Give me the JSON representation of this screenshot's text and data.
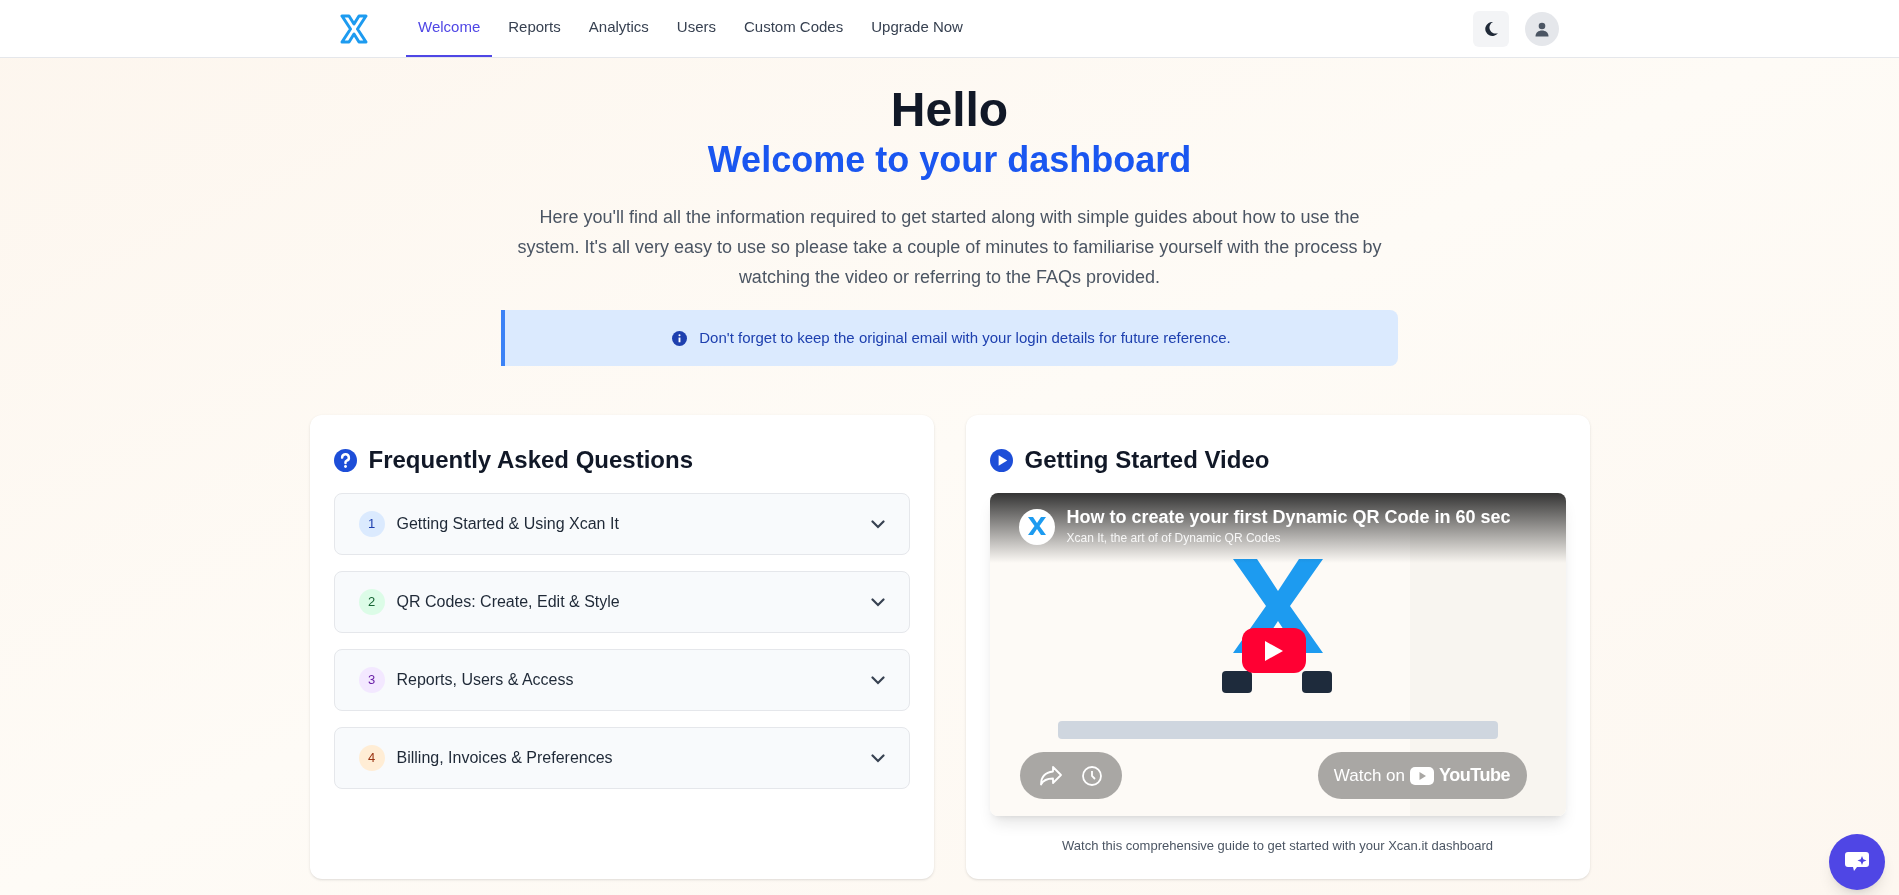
{
  "nav": {
    "tabs": [
      {
        "label": "Welcome",
        "selected": true
      },
      {
        "label": "Reports",
        "selected": false
      },
      {
        "label": "Analytics",
        "selected": false
      },
      {
        "label": "Users",
        "selected": false
      },
      {
        "label": "Custom Codes",
        "selected": false
      },
      {
        "label": "Upgrade Now",
        "selected": false
      }
    ]
  },
  "header": {
    "title": "Hello",
    "subtitle": "Welcome to your dashboard",
    "intro": "Here you'll find all the information required to get started along with simple guides about how to use the system. It's all very easy to use so please take a couple of minutes to familiarise yourself with the process by watching the video or referring to the FAQs provided.",
    "alert": "Don't forget to keep the original email with your login details for future reference."
  },
  "faq": {
    "title": "Frequently Asked Questions",
    "items": [
      {
        "number": "1",
        "label": "Getting Started & Using Xcan It",
        "color": "#dbeafe"
      },
      {
        "number": "2",
        "label": "QR Codes: Create, Edit & Style",
        "color": "#dcfce7"
      },
      {
        "number": "3",
        "label": "Reports, Users & Access",
        "color": "#f3e8ff"
      },
      {
        "number": "4",
        "label": "Billing, Invoices & Preferences",
        "color": "#ffedd5"
      }
    ]
  },
  "video": {
    "title": "Getting Started Video",
    "player": {
      "title": "How to create your first Dynamic QR Code in 60 sec",
      "channel": "Xcan It, the art of of Dynamic QR Codes",
      "watch_label": "Watch on",
      "brand": "YouTube"
    },
    "caption": "Watch this comprehensive guide to get started with your Xcan.it dashboard"
  }
}
